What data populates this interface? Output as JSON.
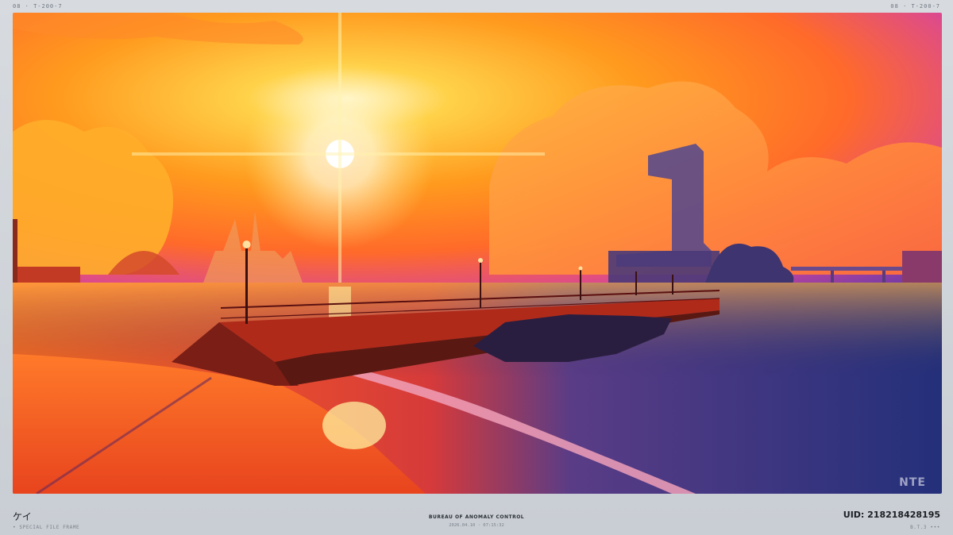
{
  "top_meta": {
    "left": "08 · T-200-7",
    "right": "08 · T-200-7"
  },
  "photo": {
    "description_icon": "sunset-seascape-photo",
    "watermark": "NTE"
  },
  "footer": {
    "name": "ケイ",
    "special": "• SPECIAL FILE FRAME",
    "bureau": "BUREAU OF ANOMALY CONTROL",
    "timestamp": "2026.04.10 · 07:15:32",
    "uid": "UID: 218218428195",
    "version": "B.T.3 •••"
  }
}
